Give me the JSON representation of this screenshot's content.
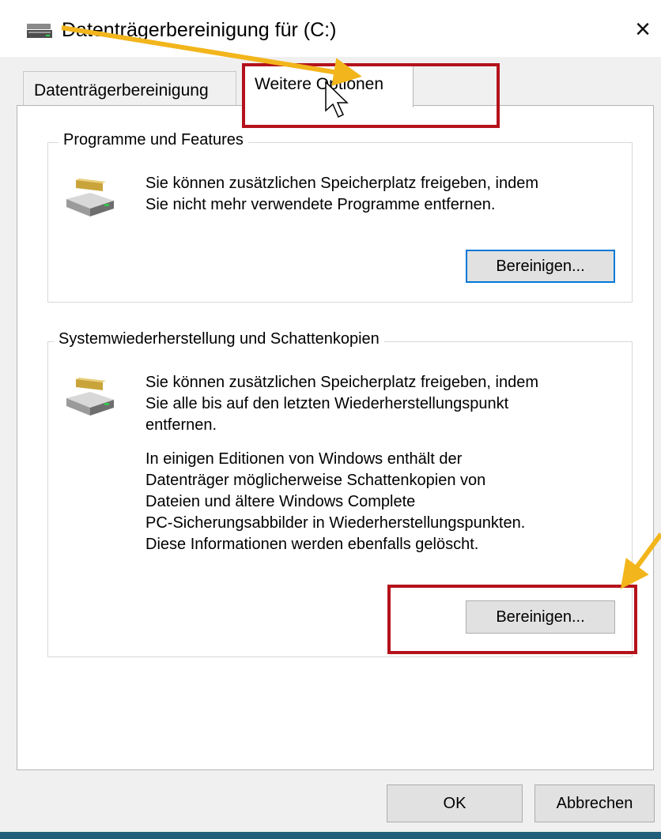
{
  "window": {
    "title": "Datenträgerbereinigung für  (C:)",
    "close_glyph": "×"
  },
  "tabs": [
    {
      "label": "Datenträgerbereinigung",
      "selected": false
    },
    {
      "label": "Weitere Optionen",
      "selected": true
    }
  ],
  "group_programs": {
    "title": "Programme und Features",
    "icon": "disk-cleanup-drive-icon",
    "lines": [
      "Sie können zusätzlichen Speicherplatz freigeben, indem",
      "Sie nicht mehr verwendete Programme entfernen."
    ],
    "button_label": "Bereinigen..."
  },
  "group_restore": {
    "title": "Systemwiederherstellung und Schattenkopien",
    "icon": "disk-cleanup-drive-icon",
    "lines": [
      "Sie können zusätzlichen Speicherplatz freigeben, indem",
      "Sie alle bis auf den letzten Wiederherstellungspunkt",
      "entfernen."
    ],
    "note_lines": [
      "In einigen Editionen von Windows enthält der",
      "Datenträger möglicherweise Schattenkopien von",
      "Dateien und ältere Windows Complete",
      "PC-Sicherungsabbilder in Wiederherstellungspunkten.",
      "Diese Informationen werden ebenfalls gelöscht."
    ],
    "button_label": "Bereinigen..."
  },
  "footer": {
    "ok_label": "OK",
    "cancel_label": "Abbrechen"
  },
  "annotations": {
    "highlight_color": "#b4121b",
    "arrow_color": "#f2b51b"
  }
}
